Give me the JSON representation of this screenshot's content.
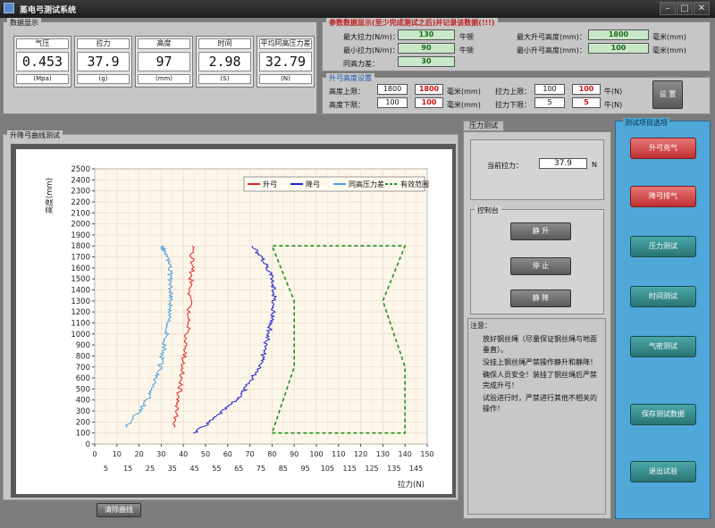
{
  "window": {
    "title": "蒸电弓测试系统"
  },
  "data_display": {
    "title": "数据显示",
    "tiles": [
      {
        "label": "气压",
        "value": "0.453",
        "unit": "(Mpa)"
      },
      {
        "label": "拉力",
        "value": "37.9",
        "unit": "(g)"
      },
      {
        "label": "高度",
        "value": "97",
        "unit": "(mm)"
      },
      {
        "label": "时间",
        "value": "2.98",
        "unit": "(S)"
      },
      {
        "label": "平均阿高压力差",
        "value": "32.79",
        "unit": "(N)"
      }
    ]
  },
  "stats": {
    "title": "参数数据显示(至少完成测试之后)并记录该数据(!!!)",
    "max_force_label": "最大拉力(N/m)：",
    "max_force": "130",
    "max_force_unit": "牛顿",
    "min_force_label": "最小拉力(N/m)：",
    "min_force": "90",
    "min_force_unit": "牛顿",
    "same_height_label": "同高力差：",
    "same_height": "30",
    "max_rise_label": "最大升弓高度(mm)：",
    "max_rise": "1800",
    "max_rise_unit": "毫米(mm)",
    "min_rise_label": "最小升弓高度(mm)：",
    "min_rise": "100",
    "min_rise_unit": "毫米(mm)"
  },
  "height_settings": {
    "title": "升弓高度设置",
    "upper_label": "高度上限：",
    "upper_input": "1800",
    "upper_value": "1800",
    "upper_unit": "毫米(mm)",
    "lower_label": "高度下限：",
    "lower_input": "100",
    "lower_value": "100",
    "lower_unit": "毫米(mm)",
    "force_upper_label": "拉力上限：",
    "force_upper_input": "100",
    "force_upper_value": "100",
    "force_upper_unit": "牛(N)",
    "force_lower_label": "拉力下限：",
    "force_lower_input": "5",
    "force_lower_value": "5",
    "force_lower_unit": "牛(N)",
    "set_button": "设 置"
  },
  "chart_section": {
    "title": "升降弓曲线测试"
  },
  "chart_data": {
    "type": "line",
    "xlabel": "拉力(N)",
    "ylabel": "高度(mm)",
    "xlim": [
      0,
      150
    ],
    "ylim": [
      0,
      2500
    ],
    "xticks_major": [
      0,
      10,
      20,
      30,
      40,
      50,
      60,
      70,
      80,
      90,
      100,
      110,
      120,
      130,
      140,
      150
    ],
    "xticks_minor": [
      5,
      15,
      25,
      35,
      45,
      55,
      65,
      75,
      85,
      95,
      105,
      115,
      125,
      135,
      145
    ],
    "yticks": [
      0,
      100,
      200,
      300,
      400,
      500,
      600,
      700,
      800,
      900,
      1000,
      1100,
      1200,
      1300,
      1400,
      1500,
      1600,
      1700,
      1800,
      1900,
      2000,
      2100,
      2200,
      2300,
      2400,
      2500
    ],
    "grid": true,
    "legend_position": "top-right",
    "series": [
      {
        "name": "升弓",
        "color": "#e02020",
        "style": "solid",
        "points": [
          [
            36,
            150
          ],
          [
            37,
            300
          ],
          [
            38,
            450
          ],
          [
            39,
            600
          ],
          [
            40,
            750
          ],
          [
            41,
            900
          ],
          [
            42,
            1050
          ],
          [
            42.5,
            1200
          ],
          [
            43,
            1350
          ],
          [
            43.5,
            1500
          ],
          [
            44,
            1650
          ],
          [
            44,
            1800
          ]
        ]
      },
      {
        "name": "降弓",
        "color": "#2020d0",
        "style": "solid",
        "points": [
          [
            45,
            100
          ],
          [
            52,
            200
          ],
          [
            58,
            300
          ],
          [
            64,
            400
          ],
          [
            68,
            500
          ],
          [
            71,
            600
          ],
          [
            74,
            700
          ],
          [
            76,
            800
          ],
          [
            77,
            900
          ],
          [
            78.5,
            1000
          ],
          [
            79.5,
            1100
          ],
          [
            80.5,
            1200
          ],
          [
            81,
            1300
          ],
          [
            81,
            1400
          ],
          [
            80,
            1500
          ],
          [
            78,
            1600
          ],
          [
            75,
            1700
          ],
          [
            71,
            1800
          ]
        ]
      },
      {
        "name": "同高压力差",
        "color": "#4aa0e0",
        "style": "solid",
        "points": [
          [
            14,
            150
          ],
          [
            18,
            250
          ],
          [
            22,
            350
          ],
          [
            25,
            450
          ],
          [
            27,
            550
          ],
          [
            29,
            650
          ],
          [
            30,
            750
          ],
          [
            31,
            850
          ],
          [
            32,
            950
          ],
          [
            33,
            1050
          ],
          [
            33.5,
            1150
          ],
          [
            34,
            1250
          ],
          [
            34.5,
            1350
          ],
          [
            34.5,
            1450
          ],
          [
            34,
            1550
          ],
          [
            33.5,
            1650
          ],
          [
            32,
            1750
          ],
          [
            30,
            1800
          ]
        ]
      },
      {
        "name": "有效范围",
        "color": "#209020",
        "style": "dashed",
        "points": [
          [
            80,
            100
          ],
          [
            140,
            100
          ],
          [
            140,
            700
          ],
          [
            130,
            1300
          ],
          [
            140,
            1800
          ],
          [
            80,
            1800
          ],
          [
            90,
            1300
          ],
          [
            90,
            700
          ],
          [
            80,
            100
          ]
        ]
      }
    ]
  },
  "pressure_tab": {
    "label": "压力测试",
    "current_force_label": "当前拉力：",
    "current_force": "37.9",
    "current_force_unit": "N"
  },
  "control": {
    "title": "控制台",
    "buttons": [
      "静 升",
      "停 止",
      "静 降"
    ]
  },
  "notes": {
    "title": "注意：",
    "lines": [
      "放好钢丝绳（尽量保证钢丝绳与地面垂直）。",
      "没挂上钢丝绳严禁操作静升和静降！",
      "确保人员安全！装挂了钢丝绳后严禁完成升弓！",
      "试验进行时，严禁进行其他不相关的操作！"
    ]
  },
  "sidebar": {
    "title": "测试项目选项",
    "buttons": [
      "升弓充气",
      "降弓排气",
      "压力测试",
      "时间测试",
      "气密测试",
      "保存测试数据",
      "退出试验"
    ]
  },
  "bottom": {
    "clear_button": "清除曲线"
  }
}
